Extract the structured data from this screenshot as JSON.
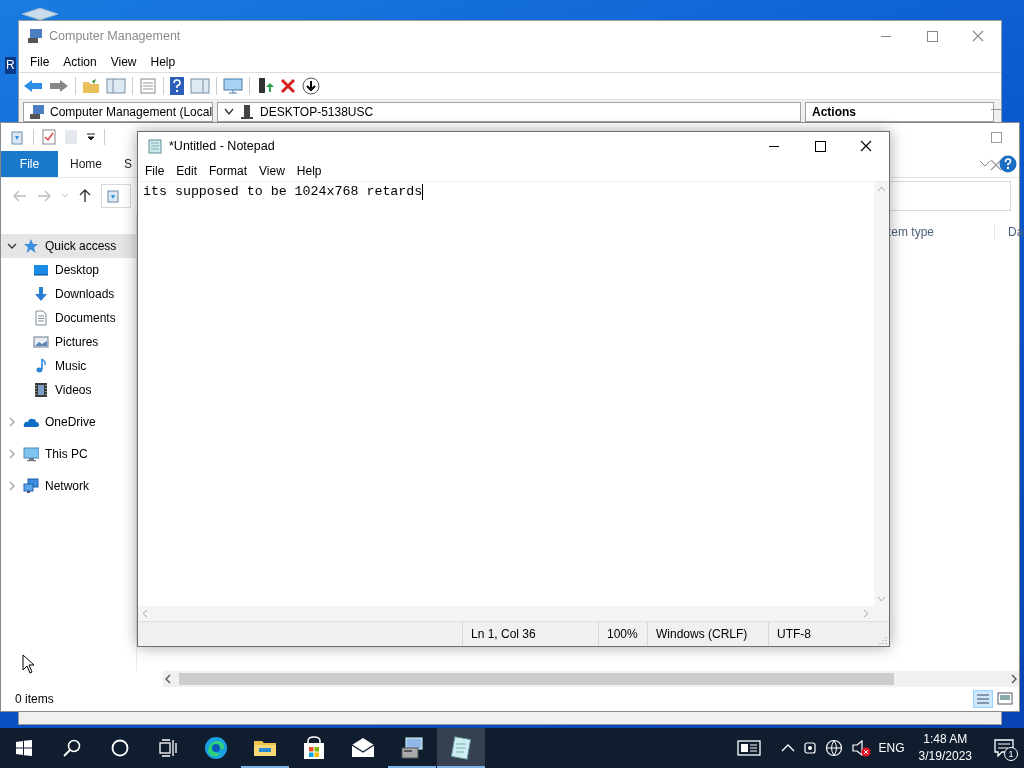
{
  "desktop": {
    "icon_label": "R"
  },
  "computer_management": {
    "title": "Computer Management",
    "menu": [
      "File",
      "Action",
      "View",
      "Help"
    ],
    "tree_header": "Computer Management (Local",
    "address": "DESKTOP-5138USC",
    "actions_header": "Actions"
  },
  "file_explorer": {
    "ribbon_tabs": [
      {
        "label": "File",
        "kind": "file"
      },
      {
        "label": "Home",
        "kind": "tab"
      },
      {
        "label": "S",
        "kind": "tab"
      }
    ],
    "navigation": [
      {
        "label": "Quick access",
        "kind": "star",
        "expanded": true,
        "selected": true,
        "children": [
          {
            "label": "Desktop",
            "kind": "desktop",
            "selected": false
          },
          {
            "label": "Downloads",
            "kind": "downloads",
            "selected": false
          },
          {
            "label": "Documents",
            "kind": "documents",
            "selected": false
          },
          {
            "label": "Pictures",
            "kind": "pictures",
            "selected": false
          },
          {
            "label": "Music",
            "kind": "music",
            "selected": false
          },
          {
            "label": "Videos",
            "kind": "videos",
            "selected": false
          }
        ]
      },
      {
        "label": "OneDrive",
        "kind": "cloud",
        "expanded": false,
        "selected": false
      },
      {
        "label": "This PC",
        "kind": "pc",
        "expanded": false,
        "selected": false
      },
      {
        "label": "Network",
        "kind": "network",
        "expanded": false,
        "selected": false
      }
    ],
    "columns": [
      "tem type",
      "Da"
    ],
    "status": "0 items"
  },
  "notepad": {
    "title": "*Untitled - Notepad",
    "menu": [
      "File",
      "Edit",
      "Format",
      "View",
      "Help"
    ],
    "text": "its supposed to be 1024x768 retards",
    "status": [
      "Ln 1, Col 36",
      "100%",
      "Windows (CRLF)",
      "UTF-8"
    ]
  },
  "taskbar": {
    "apps": [
      {
        "kind": "edge",
        "running": false,
        "selected": false
      },
      {
        "kind": "explorer",
        "running": true,
        "selected": false
      },
      {
        "kind": "store",
        "running": false,
        "selected": false
      },
      {
        "kind": "mail",
        "running": false,
        "selected": false
      },
      {
        "kind": "compmgmt",
        "running": true,
        "selected": false
      },
      {
        "kind": "notepad",
        "running": true,
        "selected": true
      }
    ],
    "language": "ENG",
    "time": "1:48 AM",
    "date": "3/19/2023",
    "notification_count": "1"
  }
}
